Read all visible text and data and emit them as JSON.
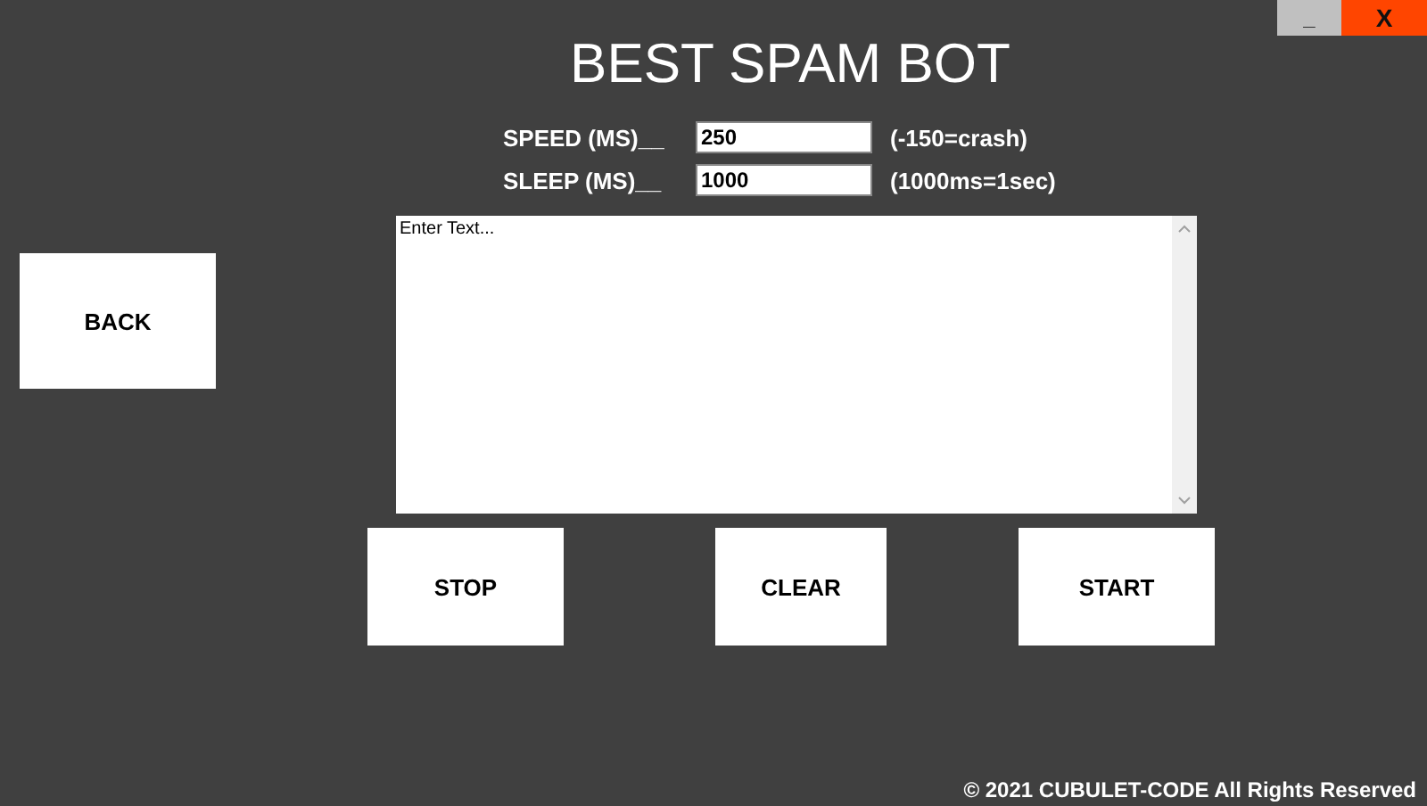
{
  "window_controls": [
    "_",
    "X"
  ],
  "title": "BEST SPAM BOT",
  "settings": [
    {
      "label": "SPEED (MS)__",
      "value": "250",
      "hint": "(-150=crash)"
    },
    {
      "label": "SLEEP (MS)__",
      "value": "1000",
      "hint": "(1000ms=1sec)"
    }
  ],
  "back_button": "BACK",
  "message": {
    "placeholder": "Enter Text..."
  },
  "buttons": [
    "STOP",
    "CLEAR",
    "START"
  ],
  "footer": "© 2021 CUBULET-CODE All Rights Reserved"
}
